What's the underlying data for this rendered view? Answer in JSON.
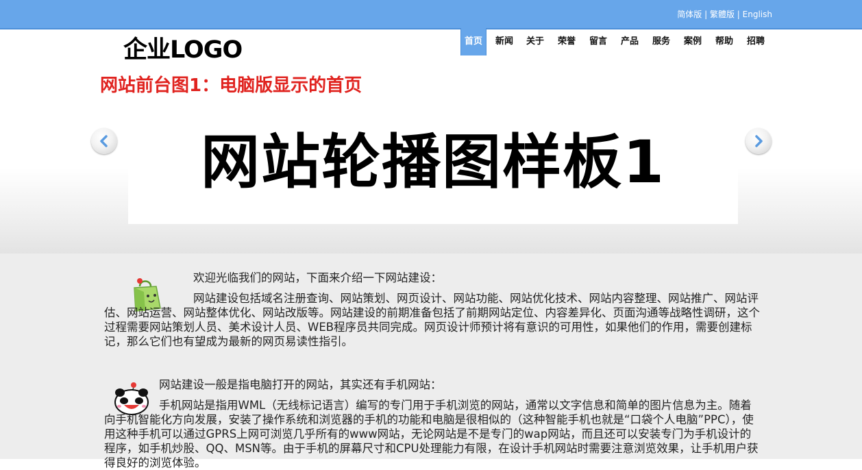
{
  "header": {
    "languages": [
      "简体版",
      "繁體版",
      "English"
    ],
    "separator": "|",
    "logo": "企业LOGO"
  },
  "nav": {
    "items": [
      "首页",
      "新闻",
      "关于",
      "荣誉",
      "留言",
      "产品",
      "服务",
      "案例",
      "帮助",
      "招聘"
    ],
    "active_index": 0
  },
  "caption": "网站前台图1：电脑版显示的首页",
  "banner": {
    "slide_text": "网站轮播图样板1",
    "prev_icon": "chevron-left-icon",
    "next_icon": "chevron-right-icon"
  },
  "content": {
    "p1_title": "欢迎光临我们的网站，下面来介绍一下网站建设：",
    "p1_body": "网站建设包括域名注册查询、网站策划、网页设计、网站功能、网站优化技术、网站内容整理、网站推广、网站评估、网站运营、网站整体优化、网站改版等。网站建设的前期准备包括了前期网站定位、内容差异化、页面沟通等战略性调研，这个过程需要网站策划人员、美术设计人员、WEB程序员共同完成。网页设计师预计将有意识的可用性，如果他们的作用，需要创建标记，那么它们也有望成为最新的网页易读性指引。",
    "p2_title": "网站建设一般是指电脑打开的网站，其实还有手机网站：",
    "p2_body": "手机网站是指用WML（无线标记语言）编写的专门用于手机浏览的网站，通常以文字信息和简单的图片信息为主。随着向手机智能化方向发展，安装了操作系统和浏览器的手机的功能和电脑是很相似的（这种智能手机也就是“口袋个人电脑”PPC），使用这种手机可以通过GPRS上网可浏览几乎所有的www网站，无论网站是不是专门的wap网站，而且还可以安装专门为手机设计的程序，如手机炒股、QQ、MSN等。由于手机的屏幕尺寸和CPU处理能力有限，在设计手机网站时需要注意浏览效果，让手机用户获得良好的浏览体验。"
  },
  "colors": {
    "topbar": "#67a6ea",
    "caption": "#e0231f",
    "content_bg": "#ededed"
  }
}
